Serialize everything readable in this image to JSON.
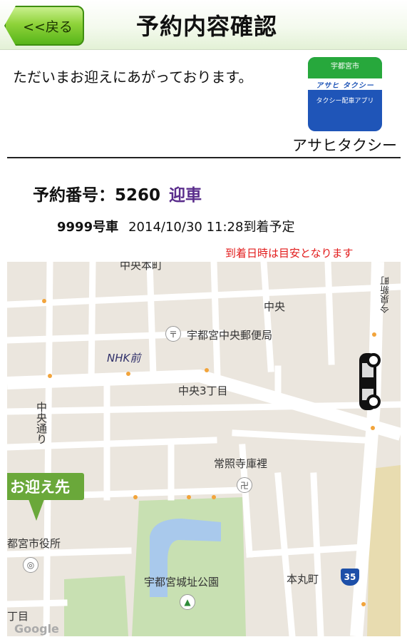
{
  "header": {
    "back_label": "<<戻る",
    "title": "予約内容確認"
  },
  "message": "ただいまお迎えにあがっております。",
  "logo": {
    "top_text": "宇都宮市",
    "band_text": "アサヒ タクシー",
    "sub_text": "タクシー配車アプリ"
  },
  "company_name": "アサヒタクシー",
  "booking": {
    "number_label": "予約番号：5260",
    "status": "迎車"
  },
  "vehicle": {
    "car": "9999号車",
    "eta": "2014/10/30 11:28到着予定"
  },
  "note": "到着日時は目安となります",
  "map": {
    "labels": {
      "top_edge": "中央本町",
      "chuo": "中央",
      "post_office": "宇都宮中央郵便局",
      "nhk": "NHK前",
      "chuo3": "中央3丁目",
      "chuo_dori": "中央通り",
      "imaizumi": "今泉新町",
      "joshoji": "常照寺庫裡",
      "city_hall": "都宮市役所",
      "castle_park": "宇都宮城址公園",
      "honmaru": "本丸町",
      "bottom_left": "丁目",
      "route": "35",
      "google": "Google"
    },
    "pin_label": "お迎え先"
  },
  "colors": {
    "header_green": "#58b51a",
    "status_purple": "#5a2d8c",
    "note_red": "#e21b1b",
    "pin_green": "#6aa83a"
  }
}
